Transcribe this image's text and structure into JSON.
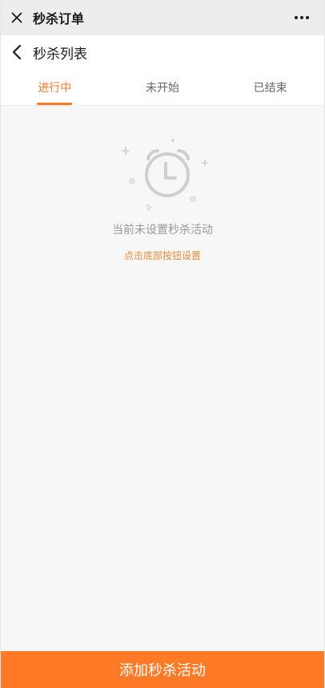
{
  "window": {
    "title": "秒杀订单",
    "close_icon": "close-icon",
    "more_icon": "more-dots-icon"
  },
  "nav": {
    "title": "秒杀列表",
    "back_icon": "chevron-left-icon"
  },
  "tabs": [
    {
      "label": "进行中",
      "active": true
    },
    {
      "label": "未开始",
      "active": false
    },
    {
      "label": "已结束",
      "active": false
    }
  ],
  "empty_state": {
    "icon": "alarm-clock-icon",
    "message": "当前未设置秒杀活动",
    "hint": "点击底部按钮设置"
  },
  "bottom_button": {
    "label": "添加秒杀活动"
  },
  "colors": {
    "accent": "#ff7a26",
    "hint": "#e98b3a"
  }
}
